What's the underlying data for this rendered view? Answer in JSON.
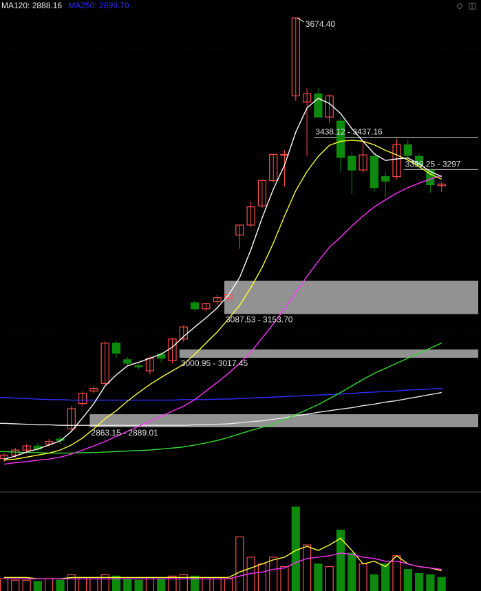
{
  "legend": {
    "ma120_label": "MA120: 2888.16",
    "ma250_label": "MA250: 2899.70",
    "ma120_color": "#e8e8e8",
    "ma250_color": "#2f2fff"
  },
  "toolbar": {
    "draw_icon": "diamond-icon",
    "window_icon": "window-icon"
  },
  "chart_data": {
    "type": "candlestick",
    "ylim": [
      2735,
      3710
    ],
    "colors": {
      "up": "#ff4d4d",
      "down": "#0c8a0c",
      "ma5": "#ffffff",
      "ma10": "#ffff33",
      "ma20": "#ff33ff",
      "ma60": "#33dd33",
      "ma120": "#e8e8e8",
      "ma250": "#2f2fff",
      "zone": "#9a9a9a"
    },
    "candles": [
      {
        "o": 2801,
        "h": 2812,
        "l": 2795,
        "c": 2808
      },
      {
        "o": 2808,
        "h": 2822,
        "l": 2803,
        "c": 2818
      },
      {
        "o": 2818,
        "h": 2830,
        "l": 2812,
        "c": 2826
      },
      {
        "o": 2826,
        "h": 2832,
        "l": 2815,
        "c": 2820
      },
      {
        "o": 2830,
        "h": 2840,
        "l": 2825,
        "c": 2835
      },
      {
        "o": 2840,
        "h": 2846,
        "l": 2830,
        "c": 2837
      },
      {
        "o": 2860,
        "h": 2905,
        "l": 2855,
        "c": 2900
      },
      {
        "o": 2910,
        "h": 2935,
        "l": 2905,
        "c": 2930
      },
      {
        "o": 2935,
        "h": 2945,
        "l": 2930,
        "c": 2940
      },
      {
        "o": 2950,
        "h": 3033,
        "l": 2945,
        "c": 3030
      },
      {
        "o": 3030,
        "h": 3035,
        "l": 3000,
        "c": 3010
      },
      {
        "o": 2997,
        "h": 3002,
        "l": 2985,
        "c": 2990
      },
      {
        "o": 2985,
        "h": 2990,
        "l": 2978,
        "c": 2983
      },
      {
        "o": 2975,
        "h": 3005,
        "l": 2968,
        "c": 3000
      },
      {
        "o": 3008,
        "h": 3012,
        "l": 2992,
        "c": 3000
      },
      {
        "o": 2995,
        "h": 3040,
        "l": 2990,
        "c": 3038
      },
      {
        "o": 3038,
        "h": 3065,
        "l": 3032,
        "c": 3062
      },
      {
        "o": 3110,
        "h": 3115,
        "l": 3093,
        "c": 3098
      },
      {
        "o": 3098,
        "h": 3110,
        "l": 3093,
        "c": 3108
      },
      {
        "o": 3112,
        "h": 3125,
        "l": 3105,
        "c": 3120
      },
      {
        "o": 3118,
        "h": 3127,
        "l": 3112,
        "c": 3126
      },
      {
        "o": 3244,
        "h": 3264,
        "l": 3217,
        "c": 3264
      },
      {
        "o": 3264,
        "h": 3310,
        "l": 3260,
        "c": 3300
      },
      {
        "o": 3302,
        "h": 3350,
        "l": 3298,
        "c": 3352
      },
      {
        "o": 3352,
        "h": 3405,
        "l": 3348,
        "c": 3404
      },
      {
        "o": 3404,
        "h": 3412,
        "l": 3340,
        "c": 3404
      },
      {
        "o": 3520,
        "h": 3674.4,
        "l": 3510,
        "c": 3674.4
      },
      {
        "o": 3508,
        "h": 3535,
        "l": 3400,
        "c": 3524
      },
      {
        "o": 3524,
        "h": 3535,
        "l": 3485,
        "c": 3478
      },
      {
        "o": 3478,
        "h": 3523,
        "l": 3467,
        "c": 3520
      },
      {
        "o": 3470,
        "h": 3478,
        "l": 3370,
        "c": 3398
      },
      {
        "o": 3400,
        "h": 3410,
        "l": 3325,
        "c": 3373
      },
      {
        "o": 3373,
        "h": 3430,
        "l": 3368,
        "c": 3403
      },
      {
        "o": 3400,
        "h": 3404,
        "l": 3330,
        "c": 3338
      },
      {
        "o": 3360,
        "h": 3371,
        "l": 3320,
        "c": 3351
      },
      {
        "o": 3360,
        "h": 3435,
        "l": 3355,
        "c": 3423
      },
      {
        "o": 3423,
        "h": 3433,
        "l": 3390,
        "c": 3402
      },
      {
        "o": 3400,
        "h": 3405,
        "l": 3375,
        "c": 3383
      },
      {
        "o": 3372,
        "h": 3376,
        "l": 3328,
        "c": 3344
      },
      {
        "o": 3342,
        "h": 3350,
        "l": 3330,
        "c": 3345
      }
    ],
    "ma5": [
      2800,
      2806,
      2814,
      2820,
      2828,
      2836,
      2855,
      2882,
      2910,
      2945,
      2967,
      2985,
      2992,
      3000,
      3008,
      3022,
      3043,
      3062,
      3080,
      3100,
      3125,
      3160,
      3215,
      3278,
      3335,
      3383,
      3448,
      3496,
      3515,
      3505,
      3485,
      3455,
      3430,
      3405,
      3392,
      3395,
      3397,
      3385,
      3370,
      3360
    ],
    "ma10": [
      2798,
      2800,
      2804,
      2808,
      2812,
      2818,
      2828,
      2842,
      2860,
      2880,
      2896,
      2915,
      2932,
      2948,
      2962,
      2975,
      2988,
      3008,
      3030,
      3052,
      3078,
      3105,
      3140,
      3180,
      3228,
      3282,
      3332,
      3370,
      3400,
      3422,
      3430,
      3432,
      3430,
      3423,
      3412,
      3403,
      3393,
      3380,
      3365,
      3355
    ],
    "ma20": [
      2790,
      2793,
      2795,
      2798,
      2800,
      2804,
      2810,
      2818,
      2826,
      2835,
      2845,
      2855,
      2865,
      2875,
      2885,
      2895,
      2905,
      2918,
      2935,
      2952,
      2970,
      2990,
      3012,
      3040,
      3068,
      3098,
      3130,
      3162,
      3192,
      3220,
      3240,
      3262,
      3282,
      3300,
      3314,
      3327,
      3338,
      3347,
      3355,
      3362
    ],
    "ma60": [
      2815,
      2814,
      2813,
      2813,
      2812,
      2812,
      2812,
      2813,
      2813,
      2814,
      2815,
      2816,
      2817,
      2818,
      2820,
      2822,
      2824,
      2828,
      2832,
      2837,
      2843,
      2850,
      2857,
      2863,
      2870,
      2878,
      2888,
      2898,
      2908,
      2920,
      2932,
      2945,
      2958,
      2970,
      2980,
      2990,
      3000,
      3010,
      3020,
      3030
    ],
    "ma120": [
      2871,
      2870,
      2869,
      2868,
      2868,
      2867,
      2867,
      2867,
      2867,
      2867,
      2867,
      2867,
      2867,
      2867,
      2867,
      2867,
      2867,
      2868,
      2868,
      2869,
      2870,
      2872,
      2874,
      2876,
      2879,
      2882,
      2886,
      2889,
      2893,
      2896,
      2899,
      2902,
      2906,
      2909,
      2913,
      2916,
      2920,
      2924,
      2928,
      2932
    ],
    "ma250": [
      2922,
      2921,
      2920,
      2919,
      2918,
      2918,
      2917,
      2917,
      2917,
      2917,
      2917,
      2917,
      2917,
      2917,
      2917,
      2917,
      2918,
      2918,
      2918,
      2919,
      2919,
      2920,
      2921,
      2922,
      2923,
      2924,
      2925,
      2926,
      2927,
      2928,
      2929,
      2930,
      2932,
      2933,
      2934,
      2935,
      2937,
      2938,
      2939,
      2940
    ],
    "zones": [
      {
        "from_index": 20,
        "low": 3087.53,
        "high": 3153.7,
        "label": "3087.53 - 3153.70"
      },
      {
        "from_index": 16,
        "low": 3000.95,
        "high": 3017.45,
        "label": "3000.95 - 3017.45"
      },
      {
        "from_index": 8,
        "low": 2863.15,
        "high": 2889.01,
        "label": "2863.15 - 2889.01"
      }
    ],
    "levels": [
      {
        "from_index": 28,
        "value": 3438,
        "label": "3438.12 - 3437.16"
      },
      {
        "from_index": 36,
        "value": 3374,
        "label": "3399.25 - 3297"
      }
    ],
    "peak": {
      "index": 26,
      "value": 3674.4,
      "label": "3674.40"
    },
    "volume": [
      {
        "v": 9,
        "up": true
      },
      {
        "v": 8,
        "up": true
      },
      {
        "v": 8,
        "up": true
      },
      {
        "v": 7,
        "up": false
      },
      {
        "v": 9,
        "up": true
      },
      {
        "v": 8,
        "up": false
      },
      {
        "v": 12,
        "up": true
      },
      {
        "v": 10,
        "up": true
      },
      {
        "v": 9,
        "up": true
      },
      {
        "v": 12,
        "up": true
      },
      {
        "v": 11,
        "up": false
      },
      {
        "v": 9,
        "up": false
      },
      {
        "v": 8,
        "up": false
      },
      {
        "v": 10,
        "up": true
      },
      {
        "v": 9,
        "up": false
      },
      {
        "v": 11,
        "up": true
      },
      {
        "v": 12,
        "up": true
      },
      {
        "v": 11,
        "up": false
      },
      {
        "v": 10,
        "up": true
      },
      {
        "v": 10,
        "up": true
      },
      {
        "v": 9,
        "up": true
      },
      {
        "v": 40,
        "up": true
      },
      {
        "v": 25,
        "up": true
      },
      {
        "v": 20,
        "up": true
      },
      {
        "v": 25,
        "up": true
      },
      {
        "v": 18,
        "up": true
      },
      {
        "v": 62,
        "up": false
      },
      {
        "v": 34,
        "up": true
      },
      {
        "v": 20,
        "up": false
      },
      {
        "v": 18,
        "up": true
      },
      {
        "v": 45,
        "up": false
      },
      {
        "v": 28,
        "up": false
      },
      {
        "v": 20,
        "up": true
      },
      {
        "v": 12,
        "up": false
      },
      {
        "v": 20,
        "up": false
      },
      {
        "v": 26,
        "up": true
      },
      {
        "v": 16,
        "up": false
      },
      {
        "v": 13,
        "up": false
      },
      {
        "v": 12,
        "up": false
      },
      {
        "v": 10,
        "up": false
      }
    ],
    "vol_ma5": [
      10,
      10,
      10,
      9,
      9,
      9,
      10,
      10,
      10,
      10,
      10,
      10,
      10,
      10,
      10,
      10,
      10,
      10,
      10,
      10,
      10,
      14,
      17,
      20,
      23,
      25,
      30,
      33,
      30,
      34,
      39,
      30,
      20,
      22,
      18,
      26,
      20,
      18,
      17,
      15
    ],
    "vol_ma10": [
      9,
      9,
      9,
      9,
      9,
      9,
      9,
      9,
      9,
      9,
      9,
      9,
      9,
      9,
      9,
      9,
      9,
      9,
      9,
      9,
      9,
      11,
      13,
      14,
      16,
      17,
      21,
      24,
      25,
      26,
      28,
      27,
      25,
      24,
      22,
      22,
      20,
      18,
      17,
      16
    ]
  }
}
